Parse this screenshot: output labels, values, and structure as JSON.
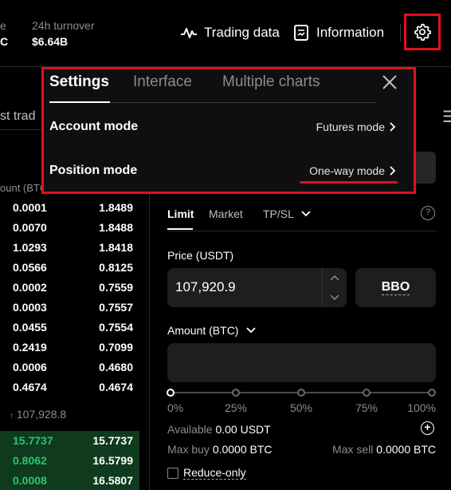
{
  "topbar": {
    "stat1_label": "e",
    "stat1_value": "C",
    "turnover_label": "24h turnover",
    "turnover_value": "$6.64B",
    "trading_data_label": "Trading data",
    "information_label": "Information"
  },
  "left_panel": {
    "tab_label": "st trad",
    "amount_header": "ount (BTC"
  },
  "orderbook": {
    "asks": [
      {
        "amount": "0.0001",
        "total": "1.8489"
      },
      {
        "amount": "0.0070",
        "total": "1.8488"
      },
      {
        "amount": "1.0293",
        "total": "1.8418"
      },
      {
        "amount": "0.0566",
        "total": "0.8125"
      },
      {
        "amount": "0.0002",
        "total": "0.7559"
      },
      {
        "amount": "0.0003",
        "total": "0.7557"
      },
      {
        "amount": "0.0455",
        "total": "0.7554"
      },
      {
        "amount": "0.2419",
        "total": "0.7099"
      },
      {
        "amount": "0.0006",
        "total": "0.4680"
      },
      {
        "amount": "0.4674",
        "total": "0.4674"
      }
    ],
    "mid_price": "107,928.8",
    "bids": [
      {
        "amount": "15.7737",
        "total": "15.7737"
      },
      {
        "amount": "0.8062",
        "total": "16.5799"
      },
      {
        "amount": "0.0008",
        "total": "16.5807"
      }
    ]
  },
  "settings": {
    "tabs": [
      "Settings",
      "Interface",
      "Multiple charts"
    ],
    "account_mode_label": "Account mode",
    "account_mode_value": "Futures mode",
    "position_mode_label": "Position mode",
    "position_mode_value": "One-way mode"
  },
  "trade": {
    "tabs": [
      "Limit",
      "Market",
      "TP/SL"
    ],
    "price_label": "Price (USDT)",
    "price_value": "107,920.9",
    "bbo_label": "BBO",
    "amount_label": "Amount (BTC)",
    "amount_value": "",
    "slider_marks": [
      "0%",
      "25%",
      "50%",
      "75%",
      "100%"
    ],
    "available_label": "Available",
    "available_value": "0.00 USDT",
    "max_buy_label": "Max buy",
    "max_buy_value": "0.0000 BTC",
    "max_sell_label": "Max sell",
    "max_sell_value": "0.0000 BTC",
    "reduce_only_label": "Reduce-only"
  },
  "colors": {
    "highlight": "#e0111c",
    "bid_green": "#28c76f",
    "ask_depth": "#3a1520",
    "bid_depth": "#0f3a1e"
  }
}
